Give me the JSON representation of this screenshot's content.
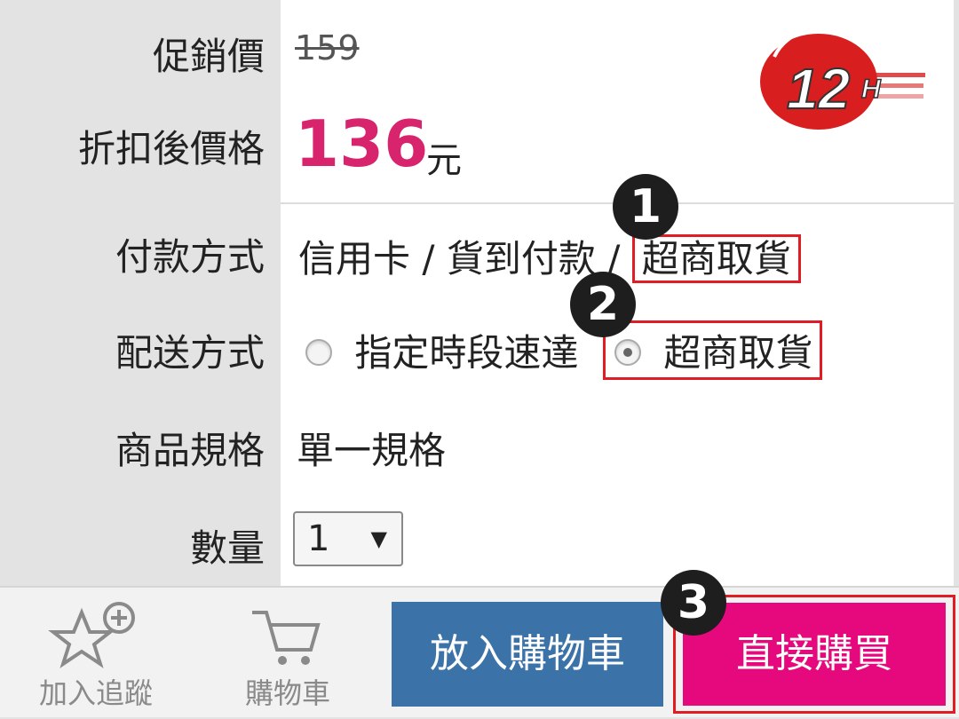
{
  "product": {
    "promo_label": "促銷價",
    "original_price": "159",
    "discount_label": "折扣後價格",
    "final_price": "136",
    "currency": "元",
    "badge": {
      "number": "12",
      "suffix": "H"
    }
  },
  "payment": {
    "label": "付款方式",
    "methods": "信用卡 / 貨到付款 / ",
    "highlighted": "超商取貨"
  },
  "delivery": {
    "label": "配送方式",
    "options": [
      {
        "label": "指定時段速達",
        "selected": false
      },
      {
        "label": "超商取貨",
        "selected": true
      }
    ]
  },
  "spec": {
    "label": "商品規格",
    "value": "單一規格"
  },
  "quantity": {
    "label": "數量",
    "value": "1",
    "arrow": "▼"
  },
  "steps": [
    "1",
    "2",
    "3"
  ],
  "bottom": {
    "track_label": "加入追蹤",
    "cart_icon_label": "購物車",
    "add_to_cart": "放入購物車",
    "buy_now": "直接購買"
  },
  "colors": {
    "price": "#d8246d",
    "highlight_border": "#e01c24",
    "cart_button": "#3b72a8",
    "buy_button": "#e6097e"
  }
}
